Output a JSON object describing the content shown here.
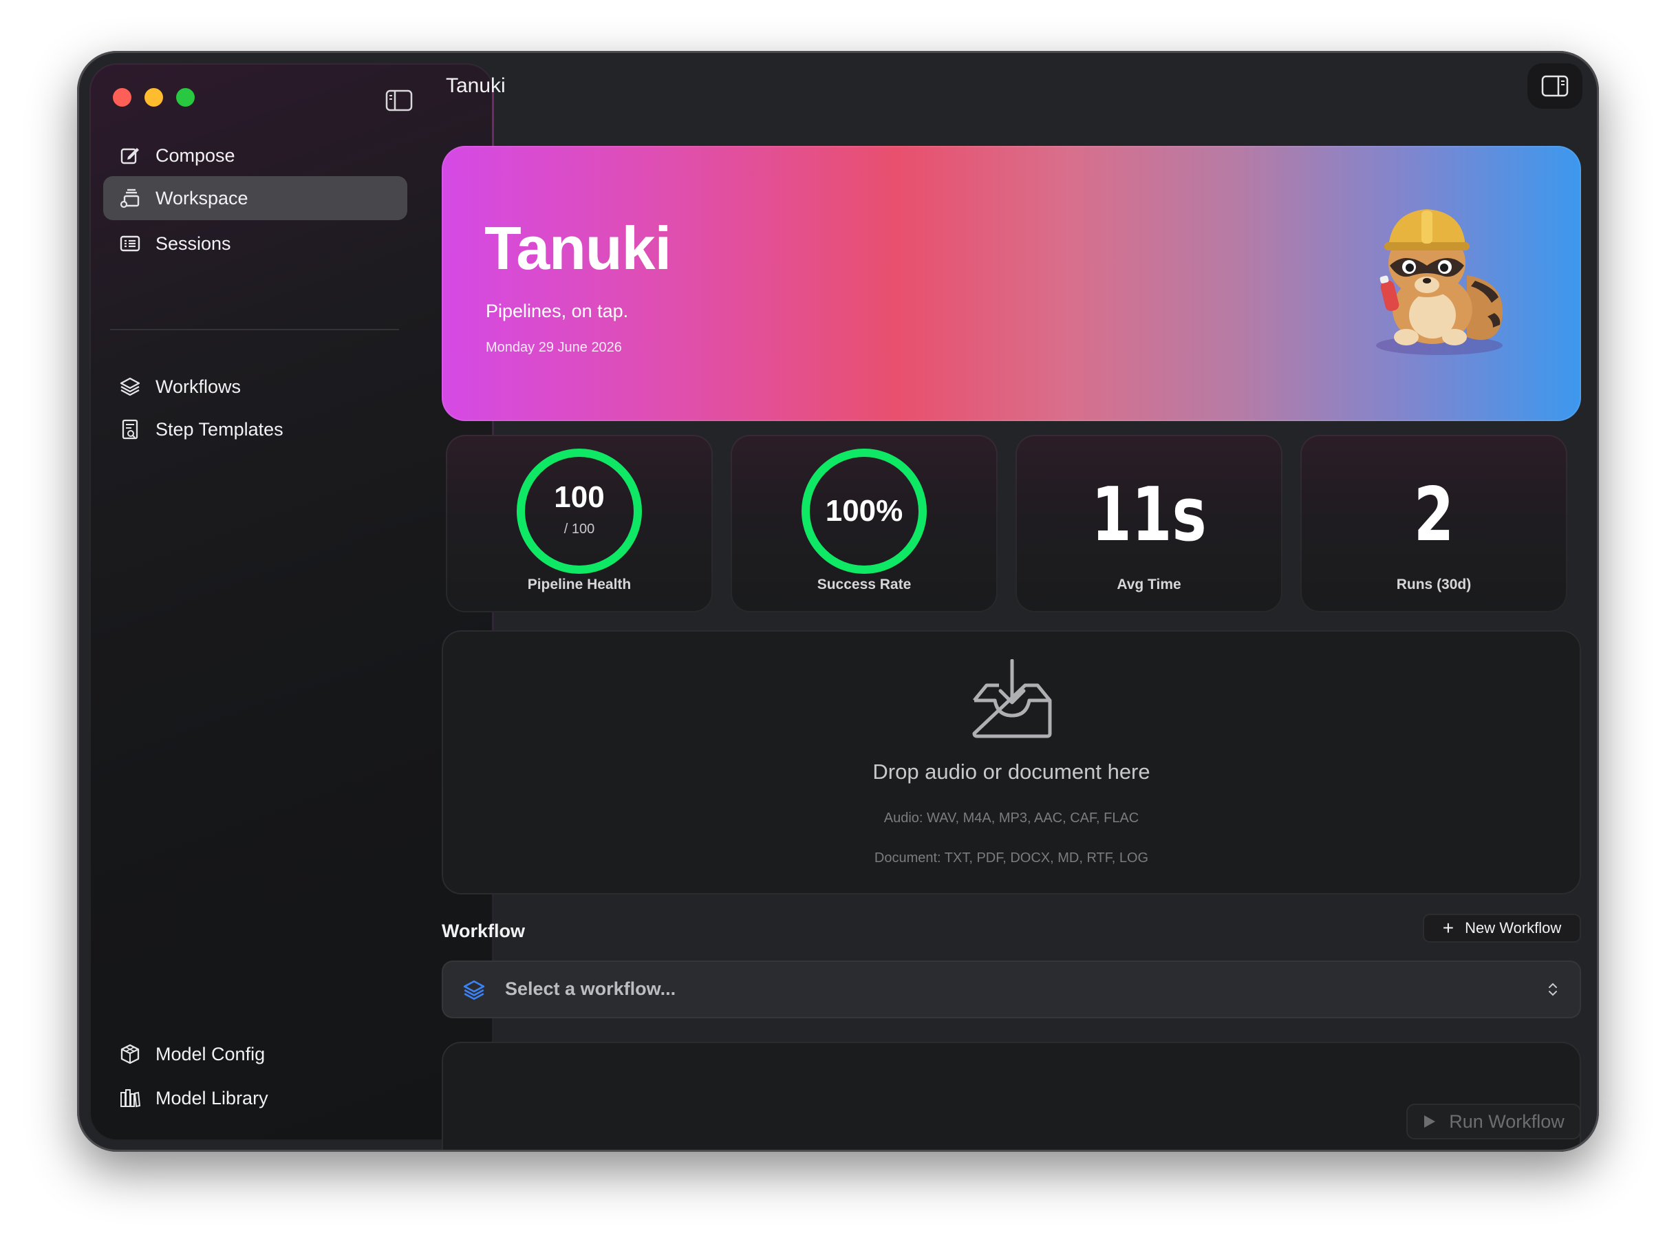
{
  "window": {
    "title": "Tanuki"
  },
  "sidebar": {
    "items": [
      {
        "label": "Compose",
        "icon": "compose-icon"
      },
      {
        "label": "Workspace",
        "icon": "workspace-icon",
        "active": true
      },
      {
        "label": "Sessions",
        "icon": "sessions-icon"
      },
      {
        "label": "Workflows",
        "icon": "layers-icon"
      },
      {
        "label": "Step Templates",
        "icon": "step-templates-icon"
      }
    ],
    "bottom_items": [
      {
        "label": "Model Config",
        "icon": "cube-icon"
      },
      {
        "label": "Model Library",
        "icon": "books-icon"
      }
    ]
  },
  "hero": {
    "title": "Tanuki",
    "subtitle": "Pipelines, on tap.",
    "date": "Monday 29 June 2026"
  },
  "stats": [
    {
      "value": "100",
      "sub": "/ 100",
      "label": "Pipeline Health",
      "fraction": 1.0
    },
    {
      "value": "100%",
      "label": "Success Rate",
      "fraction": 1.0
    },
    {
      "value": "11s",
      "label": "Avg Time"
    },
    {
      "value": "2",
      "label": "Runs (30d)"
    }
  ],
  "dropzone": {
    "title": "Drop audio or document here",
    "audio_formats": "Audio: WAV, M4A, MP3, AAC, CAF, FLAC",
    "document_formats": "Document: TXT, PDF, DOCX, MD, RTF, LOG"
  },
  "workflow": {
    "section_title": "Workflow",
    "new_button": "New Workflow",
    "select_placeholder": "Select a workflow...",
    "run_button": "Run Workflow"
  },
  "colors": {
    "ring_green": "#0ee865",
    "accent_blue": "#3b82f6",
    "hero_gradient": [
      "#d54ae6",
      "#e8506e",
      "#3c98ee"
    ]
  }
}
